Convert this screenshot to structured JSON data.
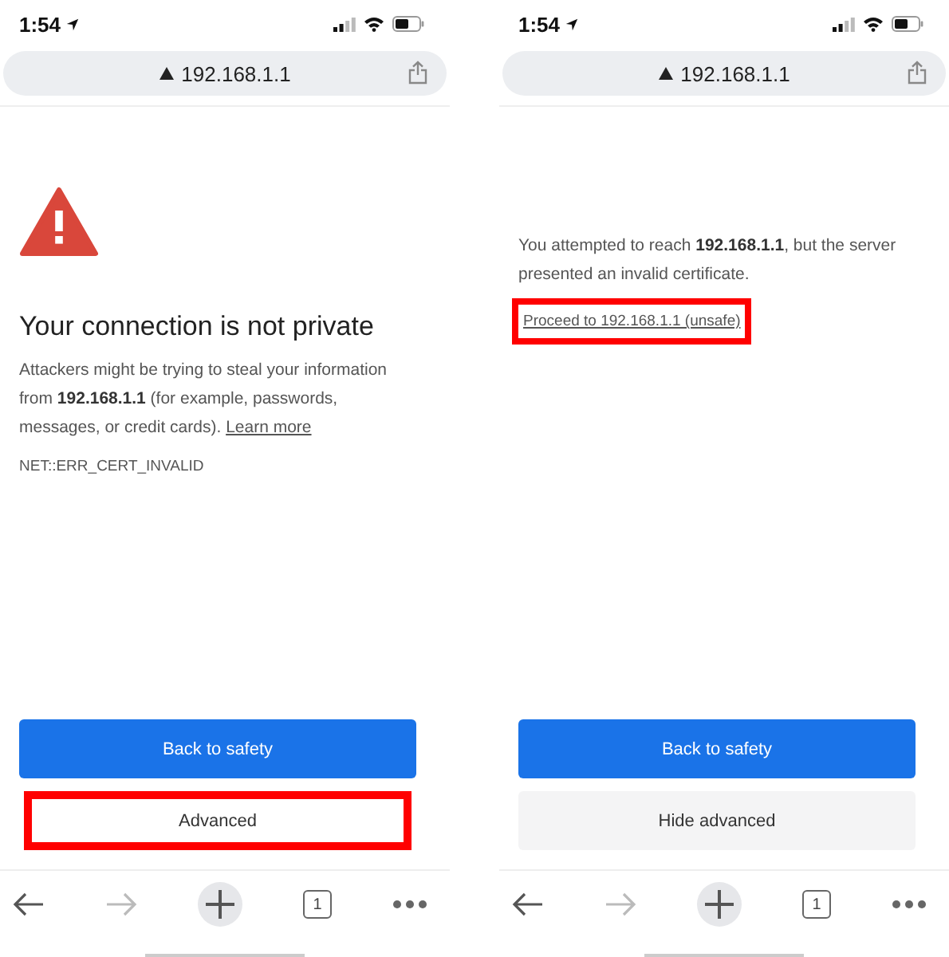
{
  "screens": [
    {
      "status_bar": {
        "time": "1:54"
      },
      "address_bar": {
        "url": "192.168.1.1"
      },
      "content": {
        "kind": "warning",
        "title": "Your connection is not private",
        "paragraph": "Attackers might be trying to steal your information from **192.168.1.1** (for example, passwords, messages, or credit cards).",
        "link": "Learn more",
        "link_highlighted": false,
        "error_code": "NET::ERR_CERT_INVALID"
      },
      "buttons": [
        {
          "label": "Back to safety",
          "kind": "primary",
          "highlighted": false
        },
        {
          "label": "Advanced",
          "kind": "secondary",
          "highlighted": true
        }
      ],
      "toolbar": {
        "tab_count": "1"
      }
    },
    {
      "status_bar": {
        "time": "1:54"
      },
      "address_bar": {
        "url": "192.168.1.1"
      },
      "content": {
        "kind": "details",
        "paragraph": "You attempted to reach **192.168.1.1**, but the server presented an invalid certificate.",
        "link": "Proceed to 192.168.1.1 (unsafe)",
        "link_highlighted": true
      },
      "buttons": [
        {
          "label": "Back to safety",
          "kind": "primary",
          "highlighted": false
        },
        {
          "label": "Hide advanced",
          "kind": "secondary",
          "highlighted": false
        }
      ],
      "toolbar": {
        "tab_count": "1"
      }
    }
  ]
}
